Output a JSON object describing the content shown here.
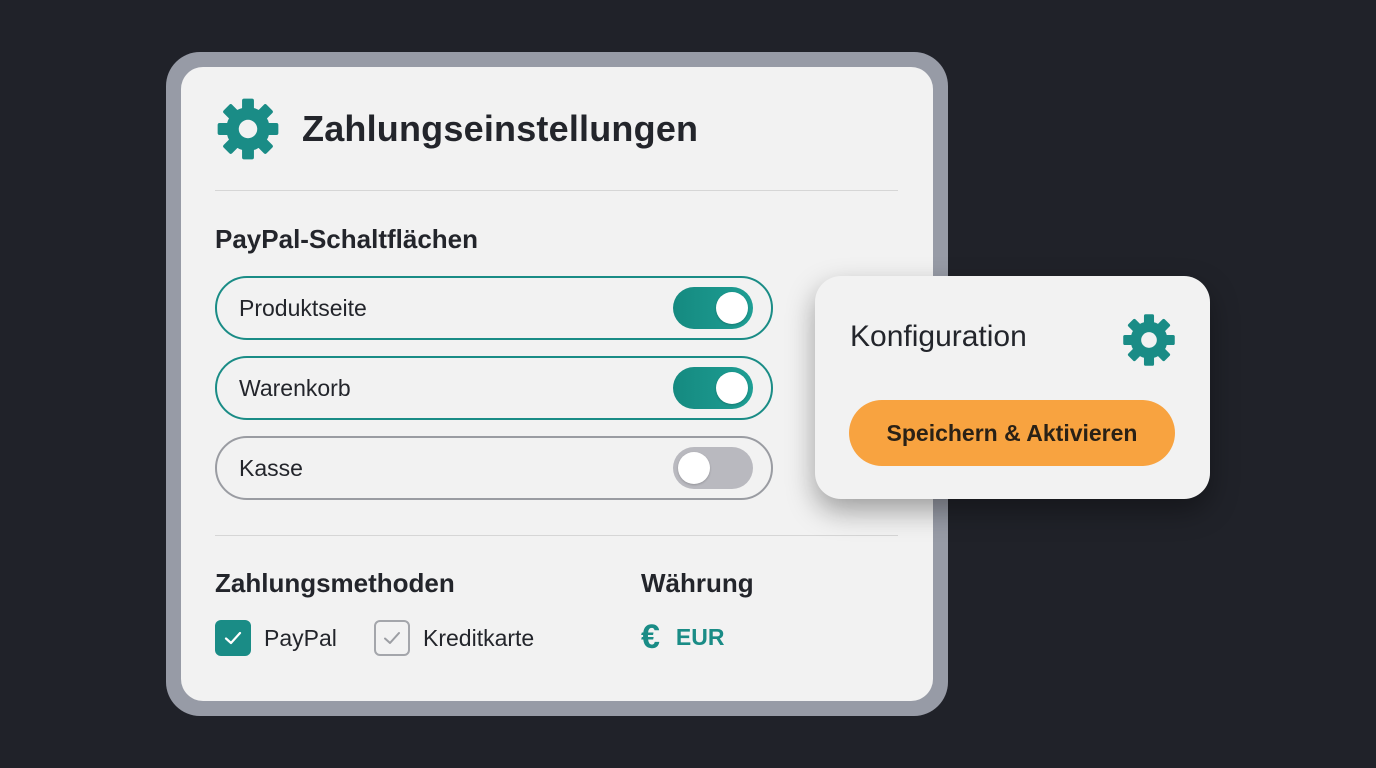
{
  "colors": {
    "background": "#202229",
    "panel": "#f2f2f2",
    "frame": "#979ba6",
    "accent_teal": "#1a8c86",
    "switch_off": "#b9b9bf",
    "button_orange": "#f8a340",
    "text": "#23252b"
  },
  "panel": {
    "icon": "gear-icon",
    "title": "Zahlungseinstellungen"
  },
  "paypal_buttons": {
    "heading": "PayPal-Schaltflächen",
    "items": [
      {
        "label": "Produktseite",
        "enabled": true
      },
      {
        "label": "Warenkorb",
        "enabled": true
      },
      {
        "label": "Kasse",
        "enabled": false
      }
    ]
  },
  "payment_methods": {
    "heading": "Zahlungsmethoden",
    "options": [
      {
        "label": "PayPal",
        "checked": true
      },
      {
        "label": "Kreditkarte",
        "checked": false
      }
    ]
  },
  "currency": {
    "heading": "Währung",
    "icon": "euro-icon",
    "symbol": "€",
    "code": "EUR"
  },
  "config_card": {
    "title": "Konfiguration",
    "icon": "gear-icon",
    "save_label": "Speichern & Aktivieren"
  }
}
